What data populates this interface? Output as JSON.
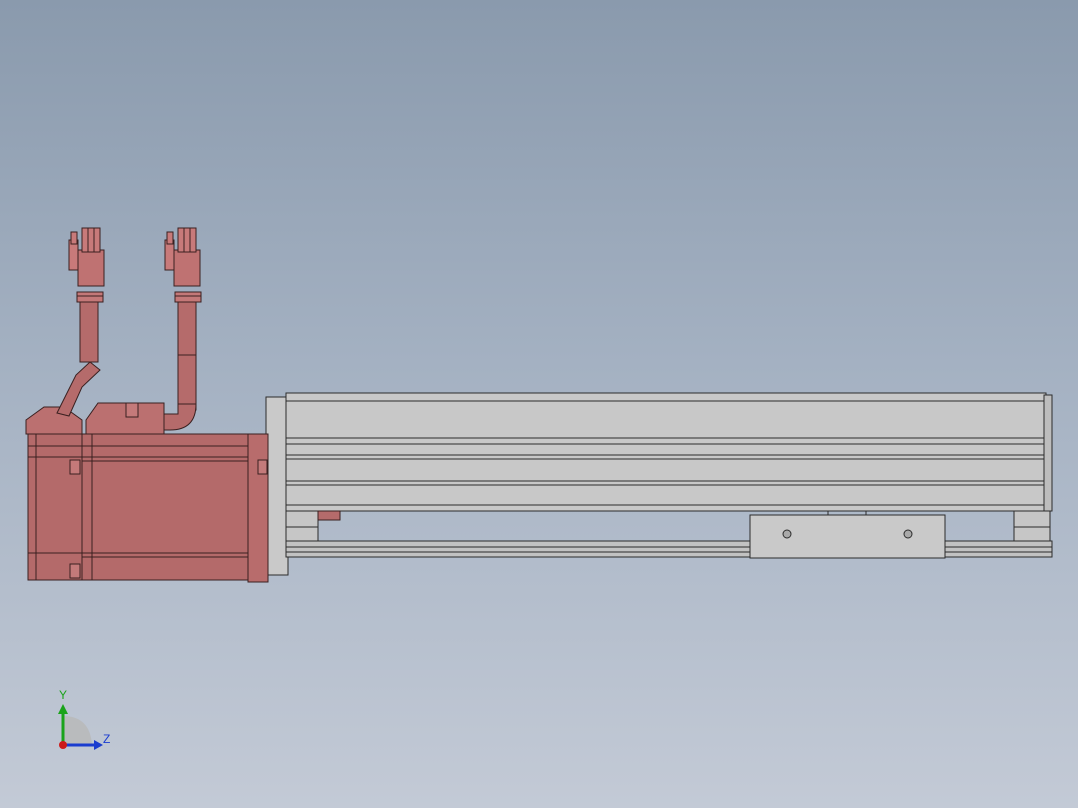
{
  "viewport": {
    "background_top": "#8a9aad",
    "background_bottom": "#c3cad6"
  },
  "model": {
    "motor_color": "#b56b6b",
    "actuator_color": "#c4c4c4",
    "edge_color": "#3a2020"
  },
  "triad": {
    "y_label": "Y",
    "z_label": "Z",
    "y_color": "#1aa31a",
    "z_color": "#1a3ccf",
    "x_color": "#cc1a1a"
  }
}
